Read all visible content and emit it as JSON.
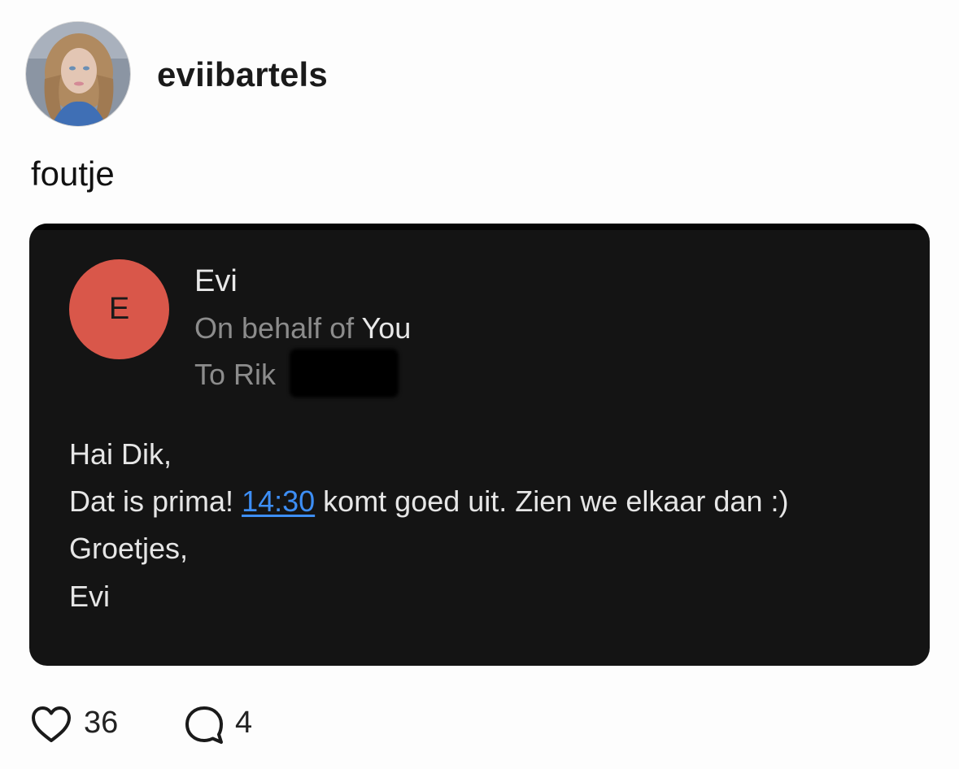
{
  "post": {
    "username": "eviibartels",
    "caption": "foutje",
    "likes": "36",
    "comments": "4"
  },
  "email": {
    "sender_initial": "E",
    "sender_name": "Evi",
    "behalf_prefix": "On behalf of",
    "behalf_name": "You",
    "to_line": "To Rik",
    "greeting": "Hai Dik,",
    "line2_before": "Dat is prima!",
    "line2_time": "14:30",
    "line2_after": "komt goed uit. Zien we elkaar dan :)",
    "closing": "Groetjes,",
    "signature": "Evi"
  },
  "colors": {
    "card_background": "#141414",
    "sender_avatar": "#d9574a",
    "link": "#3d8ef5"
  },
  "icons": {
    "like": "heart-icon",
    "comment": "comment-bubble-icon"
  }
}
